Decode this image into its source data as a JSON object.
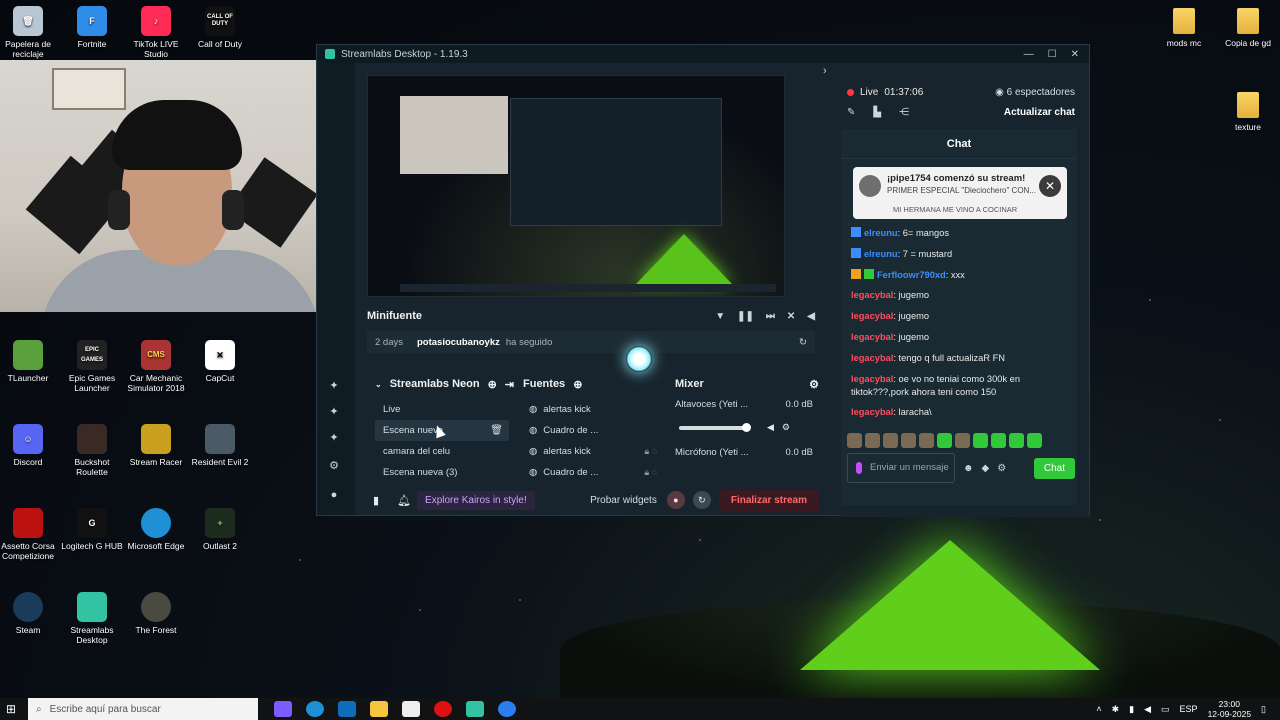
{
  "desktop": {
    "icons_left": [
      {
        "label": "Papelera de reciclaje",
        "icon": "recycle-bin-icon"
      },
      {
        "label": "Fortnite",
        "icon": "fortnite-icon"
      },
      {
        "label": "TikTok LIVE Studio",
        "icon": "tiktok-icon"
      },
      {
        "label": "Call of Duty",
        "icon": "call-of-duty-icon",
        "art": "CALL OF DUTY"
      },
      {
        "label": "TLauncher",
        "icon": "tlauncher-icon"
      },
      {
        "label": "Epic Games Launcher",
        "icon": "epic-icon",
        "art": "EPIC GAMES"
      },
      {
        "label": "Car Mechanic Simulator 2018",
        "icon": "cms-icon",
        "art": "CMS"
      },
      {
        "label": "CapCut",
        "icon": "capcut-icon"
      },
      {
        "label": "Discord",
        "icon": "discord-icon"
      },
      {
        "label": "Buckshot Roulette",
        "icon": "buckshot-icon"
      },
      {
        "label": "Stream Racer",
        "icon": "stream-racer-icon"
      },
      {
        "label": "Resident Evil 2",
        "icon": "re2-icon"
      },
      {
        "label": "Assetto Corsa Competizione",
        "icon": "acc-icon"
      },
      {
        "label": "Logitech G HUB",
        "icon": "ghub-icon"
      },
      {
        "label": "Microsoft Edge",
        "icon": "edge-icon"
      },
      {
        "label": "Outlast 2",
        "icon": "outlast-icon"
      },
      {
        "label": "Steam",
        "icon": "steam-icon"
      },
      {
        "label": "Streamlabs Desktop",
        "icon": "streamlabs-icon"
      },
      {
        "label": "The Forest",
        "icon": "forest-icon"
      }
    ],
    "icons_right": [
      {
        "label": "mods mc"
      },
      {
        "label": "Copia de gd"
      },
      {
        "label": "texture"
      }
    ]
  },
  "window": {
    "title": "Streamlabs Desktop - 1.19.3",
    "controls": [
      "—",
      "☐",
      "✕"
    ]
  },
  "activity": {
    "title": "Minifuente",
    "time": "2 days",
    "user": "potasiocubanoykz",
    "action": "ha seguido"
  },
  "scenes": {
    "title": "Streamlabs Neon",
    "items": [
      "Live",
      "Escena nueva",
      "camara del celu",
      "Escena nueva (3)"
    ]
  },
  "sources": {
    "title": "Fuentes",
    "items": [
      "alertas kick",
      "Cuadro de ...",
      "alertas kick",
      "Cuadro de ..."
    ]
  },
  "mixer": {
    "title": "Mixer",
    "ch1": "Altavoces (Yeti ...",
    "ch1_db": "0.0 dB",
    "ch1_level": 0.95,
    "ch2": "Micrófono (Yeti ...",
    "ch2_db": "0.0 dB"
  },
  "footer": {
    "kairos": "Explore Kairos in style!",
    "test_widgets": "Probar widgets",
    "end_stream": "Finalizar stream"
  },
  "stream": {
    "live_label": "Live",
    "live_time": "01:37:06",
    "viewers": "6 espectadores",
    "update_chat": "Actualizar chat"
  },
  "chat": {
    "title": "Chat",
    "notification": {
      "title": "¡pipe1754 comenzó su stream!",
      "subtitle": "PRIMER ESPECIAL \"Dieciochero\" CON...",
      "extra": "MI HERMANA ME VINO A COCINAR"
    },
    "messages": [
      {
        "user": "elreunu",
        "text": ": 6= mangos",
        "color": "#3c8dff"
      },
      {
        "user": "elreunu",
        "text": ": 7 = mustard",
        "color": "#3c8dff"
      },
      {
        "user": "Ferfloowr790xd",
        "text": ": xxx",
        "color": "#3c8dff"
      },
      {
        "user": "legacybal",
        "text": ": jugemo",
        "color": "#ff4d5e"
      },
      {
        "user": "legacybal",
        "text": ": jugemo",
        "color": "#ff4d5e"
      },
      {
        "user": "legacybal",
        "text": ": jugemo",
        "color": "#ff4d5e"
      },
      {
        "user": "legacybal",
        "text": ": tengo q full actualizaR FN",
        "color": "#ff4d5e"
      },
      {
        "user": "legacybal",
        "text": ": oe vo no teniai como 300k en tiktok???,pork ahora teni como 150",
        "color": "#ff4d5e"
      },
      {
        "user": "legacybal",
        "text": ": laracha\\",
        "color": "#ff4d5e"
      }
    ],
    "input_placeholder": "Enviar un mensaje",
    "send_label": "Chat"
  },
  "taskbar": {
    "search_placeholder": "Escribe aquí para buscar",
    "lang": "ESP",
    "time": "23:00",
    "date": "12-09-2025"
  },
  "colors": {
    "accent": "#31c3a2",
    "live": "#ff3b3b",
    "chat_button": "#31c83c",
    "end_stream": "#ff6a6a"
  }
}
